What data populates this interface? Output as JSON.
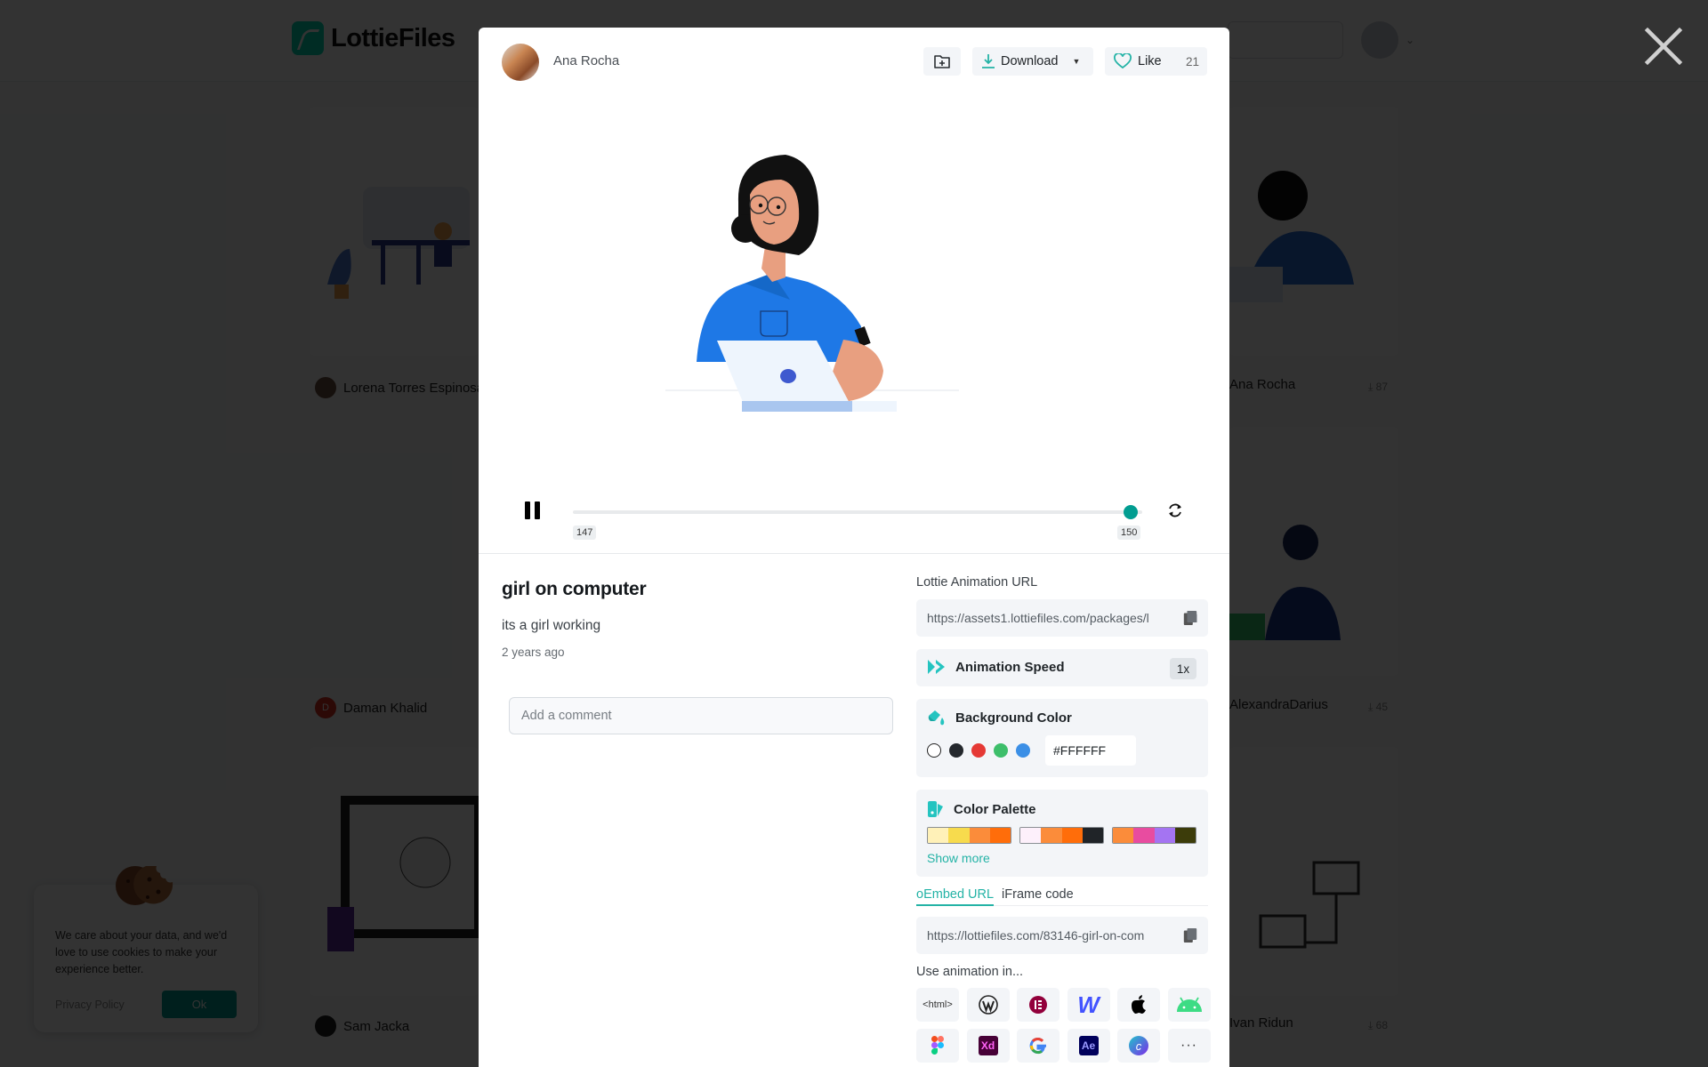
{
  "background_page": {
    "brand": "LottieFiles",
    "cards": [
      {
        "author": "Lorena Torres Espinosa",
        "downloads": null
      },
      {
        "author": "Ana Rocha",
        "downloads": "87"
      },
      {
        "author": "Daman Khalid",
        "avatar_initial": "D",
        "downloads": null
      },
      {
        "author": "AlexandraDarius",
        "downloads": "45"
      },
      {
        "author": "Sam Jacka",
        "downloads": null
      },
      {
        "author": "Ivan Ridun",
        "downloads": "68"
      }
    ],
    "cookie_banner": {
      "text": "We care about your data, and we'd love to use cookies to make your experience better.",
      "privacy_link": "Privacy Policy",
      "ok_button": "Ok"
    }
  },
  "modal": {
    "author": {
      "name": "Ana Rocha"
    },
    "header_actions": {
      "save_to_folder_icon": "folder-plus-icon",
      "download_label": "Download",
      "like_label": "Like",
      "like_count": "21"
    },
    "player": {
      "current_frame": "147",
      "total_frames": "150",
      "progress_fraction": 0.98,
      "state": "playing"
    },
    "animation": {
      "title": "girl on computer",
      "description": "its a girl working",
      "posted": "2 years ago"
    },
    "comment": {
      "placeholder": "Add a comment",
      "value": ""
    },
    "lottie_url": {
      "label": "Lottie Animation URL",
      "value": "https://assets1.lottiefiles.com/packages/l"
    },
    "speed": {
      "label": "Animation Speed",
      "value": "1x"
    },
    "background_color": {
      "label": "Background Color",
      "swatches": [
        "#FFFFFF",
        "#24282D",
        "#E53935",
        "#3DBE6A",
        "#3B8FE6"
      ],
      "value": "#FFFFFF"
    },
    "color_palette": {
      "label": "Color Palette",
      "palettes": [
        [
          "#FFF1B8",
          "#F7DB4D",
          "#FB8C3A",
          "#FF6D0A"
        ],
        [
          "#FDF0FB",
          "#FB8C3A",
          "#FF6D0A",
          "#202428"
        ],
        [
          "#FB8C3A",
          "#E84CA0",
          "#A474F2",
          "#3C3C0A"
        ]
      ],
      "show_more": "Show more"
    },
    "embed_tabs": [
      {
        "label": "oEmbed URL",
        "active": true
      },
      {
        "label": "iFrame code",
        "active": false
      }
    ],
    "embed_url": "https://lottiefiles.com/83146-girl-on-com",
    "use_in": {
      "label": "Use animation in...",
      "apps": [
        {
          "name": "html",
          "text": "<html>"
        },
        {
          "name": "wordpress"
        },
        {
          "name": "elementor"
        },
        {
          "name": "webflow"
        },
        {
          "name": "apple"
        },
        {
          "name": "android"
        },
        {
          "name": "figma"
        },
        {
          "name": "adobe-xd",
          "text": "Xd"
        },
        {
          "name": "google"
        },
        {
          "name": "after-effects",
          "text": "Ae"
        },
        {
          "name": "canva",
          "text": "c"
        },
        {
          "name": "more",
          "text": "···"
        }
      ]
    }
  },
  "colors": {
    "accent": "#019D91",
    "accent_light": "#24B3A6",
    "overlay": "rgba(0,0,0,0.8)"
  }
}
